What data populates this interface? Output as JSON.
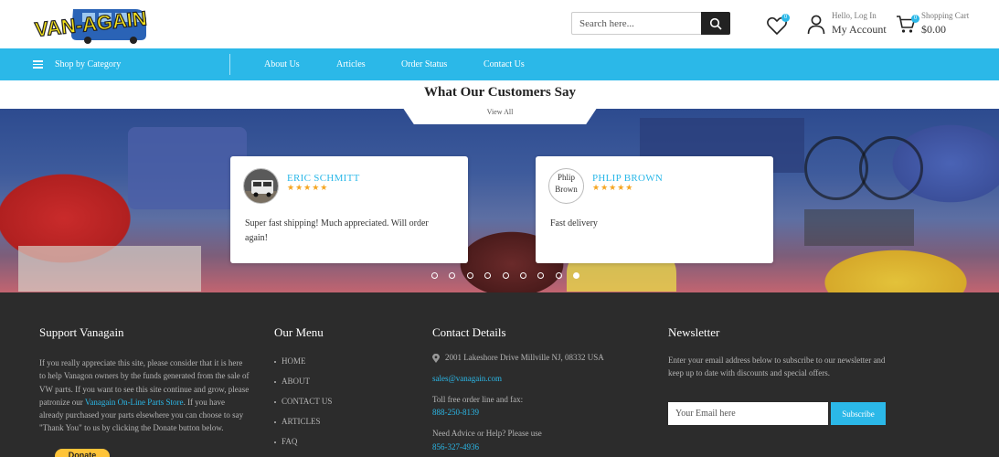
{
  "header": {
    "logo_text": "VAN-AGAIN",
    "search_placeholder": "Search here...",
    "account_small": "Hello, Log In",
    "account_big": "My Account",
    "cart_small": "Shopping Cart",
    "cart_total": "$0.00",
    "wishlist_count": "0",
    "cart_count": "0"
  },
  "nav": {
    "shop_by_category": "Shop by Category",
    "links": [
      "About Us",
      "Articles",
      "Order Status",
      "Contact Us"
    ]
  },
  "testimonials": {
    "title": "What Our Customers Say",
    "view_all": "View All",
    "stars": "★★★★★",
    "items": [
      {
        "name": "ERIC SCHMITT",
        "text": "Super fast shipping! Much appreciated. Will order again!"
      },
      {
        "name": "PHLIP BROWN",
        "text": "Fast delivery",
        "avatar_alt": "Phlip Brown"
      }
    ],
    "dot_count": 9,
    "active_dot": 8
  },
  "footer": {
    "support": {
      "title": "Support Vanagain",
      "text_before": "If you really appreciate this site, please consider that it is here to help Vanagon owners by the funds generated from the sale of VW parts. If you want to see this site continue and grow, please patronize our ",
      "link": "Vanagain On-Line Parts Store",
      "text_after": ". If you have already purchased your parts elsewhere you can choose to say \"Thank You\" to us by clicking the Donate button below.",
      "donate": "Donate"
    },
    "menu": {
      "title": "Our Menu",
      "items": [
        "HOME",
        "ABOUT",
        "CONTACT US",
        "ARTICLES",
        "FAQ"
      ]
    },
    "contact": {
      "title": "Contact Details",
      "address": "2001 Lakeshore Drive Millville NJ, 08332 USA",
      "email": "sales@vanagain.com",
      "tollfree_label": "Toll free order line and fax:",
      "tollfree": "888-250-8139",
      "advice_label": "Need Advice or Help?  Please use",
      "advice_phone": "856-327-4936"
    },
    "newsletter": {
      "title": "Newsletter",
      "text": "Enter your email address below to subscribe to our newsletter and keep up to date with discounts and special offers.",
      "placeholder": "Your Email here",
      "button": "Subscribe"
    }
  },
  "colors": {
    "accent": "#2bb8e8",
    "footer_bg": "#2c2c2c",
    "star": "#f5a623",
    "donate": "#ffc439"
  }
}
